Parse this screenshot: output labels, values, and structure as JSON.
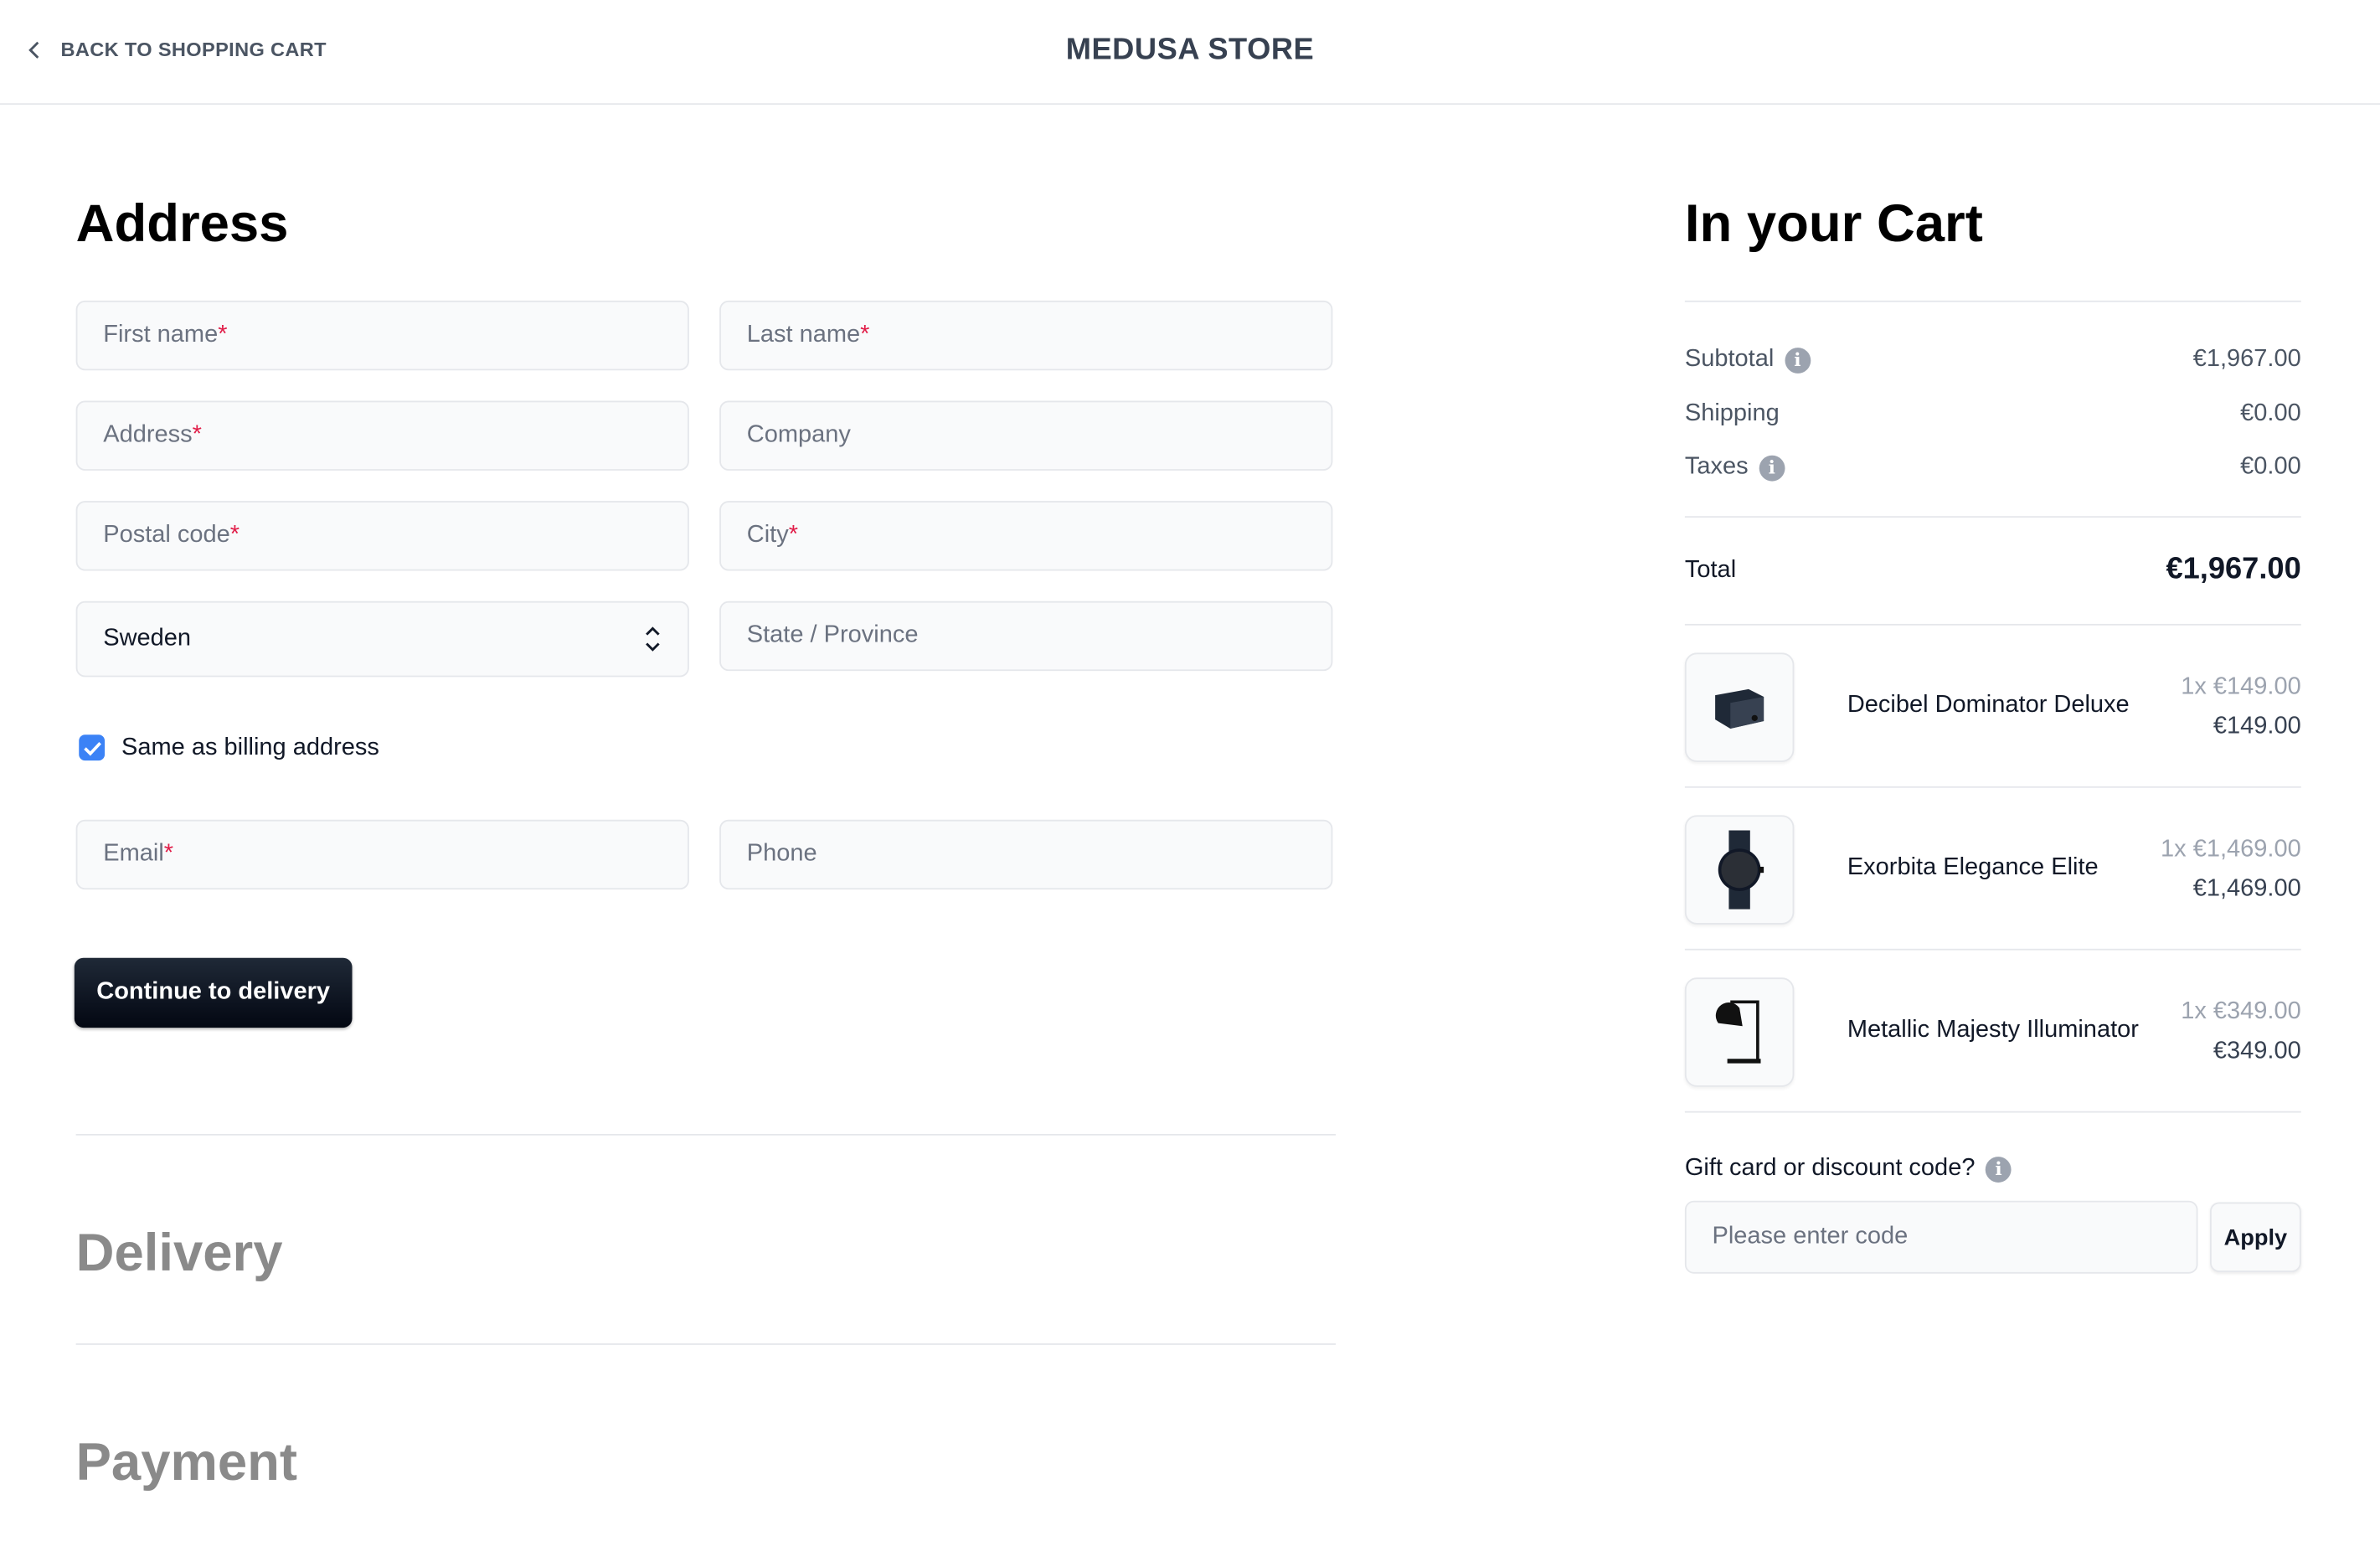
{
  "header": {
    "back_label": "BACK TO SHOPPING CART",
    "store_name": "MEDUSA STORE"
  },
  "address": {
    "title": "Address",
    "fields": {
      "first_name": "First name",
      "last_name": "Last name",
      "address": "Address",
      "company": "Company",
      "postal_code": "Postal code",
      "city": "City",
      "country": "Sweden",
      "state": "State / Province",
      "email": "Email",
      "phone": "Phone"
    },
    "required_mark": "*",
    "same_as_billing_label": "Same as billing address",
    "same_as_billing_checked": true,
    "continue_label": "Continue to delivery"
  },
  "delivery": {
    "title": "Delivery"
  },
  "payment": {
    "title": "Payment"
  },
  "cart": {
    "title": "In your Cart",
    "subtotal_label": "Subtotal",
    "subtotal": "€1,967.00",
    "shipping_label": "Shipping",
    "shipping": "€0.00",
    "taxes_label": "Taxes",
    "taxes": "€0.00",
    "total_label": "Total",
    "total": "€1,967.00",
    "items": [
      {
        "name": "Decibel Dominator Deluxe",
        "qty_price": "1x €149.00",
        "price": "€149.00",
        "icon": "speaker-icon"
      },
      {
        "name": "Exorbita Elegance Elite",
        "qty_price": "1x €1,469.00",
        "price": "€1,469.00",
        "icon": "watch-icon"
      },
      {
        "name": "Metallic Majesty Illuminator",
        "qty_price": "1x €349.00",
        "price": "€349.00",
        "icon": "lamp-icon"
      }
    ],
    "discount_label": "Gift card or discount code?",
    "discount_placeholder": "Please enter code",
    "apply_label": "Apply"
  },
  "colors": {
    "accent": "#3b82f6",
    "required": "#e11d48",
    "button": "#111827"
  }
}
